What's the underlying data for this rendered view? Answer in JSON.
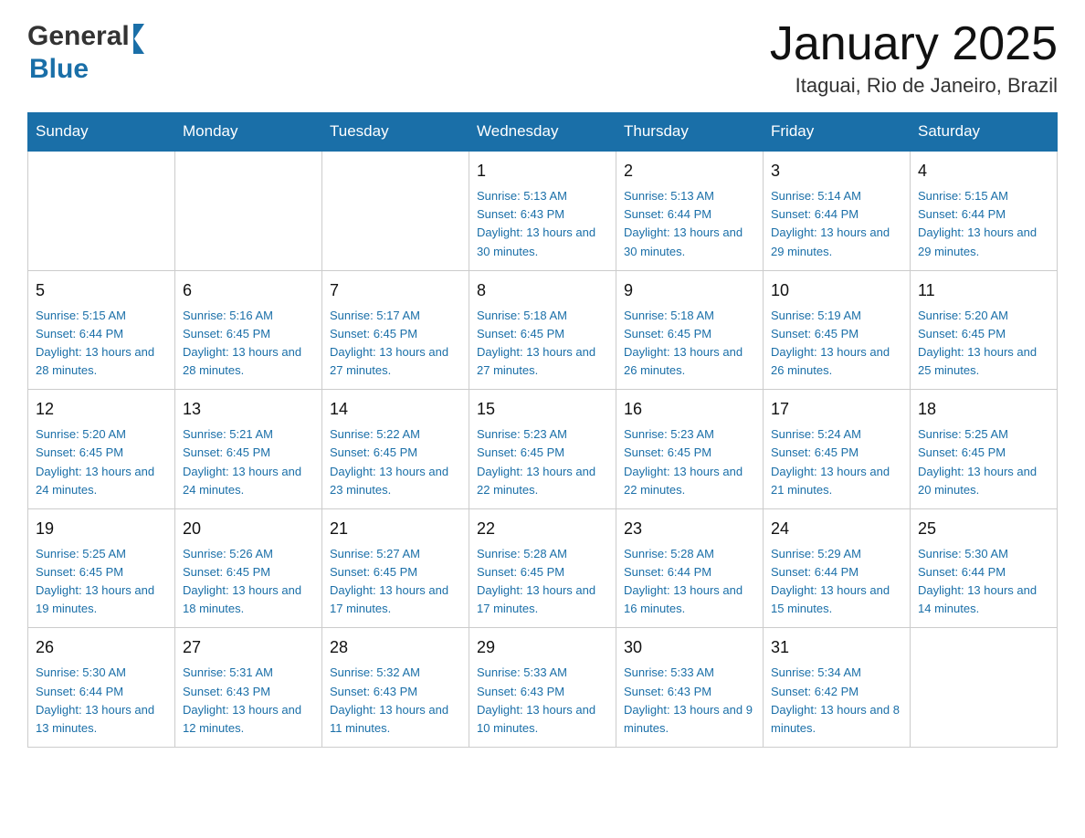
{
  "header": {
    "title": "January 2025",
    "subtitle": "Itaguai, Rio de Janeiro, Brazil",
    "logo_general": "General",
    "logo_blue": "Blue"
  },
  "days_of_week": [
    "Sunday",
    "Monday",
    "Tuesday",
    "Wednesday",
    "Thursday",
    "Friday",
    "Saturday"
  ],
  "weeks": [
    {
      "days": [
        {
          "num": "",
          "info": ""
        },
        {
          "num": "",
          "info": ""
        },
        {
          "num": "",
          "info": ""
        },
        {
          "num": "1",
          "info": "Sunrise: 5:13 AM\nSunset: 6:43 PM\nDaylight: 13 hours and 30 minutes."
        },
        {
          "num": "2",
          "info": "Sunrise: 5:13 AM\nSunset: 6:44 PM\nDaylight: 13 hours and 30 minutes."
        },
        {
          "num": "3",
          "info": "Sunrise: 5:14 AM\nSunset: 6:44 PM\nDaylight: 13 hours and 29 minutes."
        },
        {
          "num": "4",
          "info": "Sunrise: 5:15 AM\nSunset: 6:44 PM\nDaylight: 13 hours and 29 minutes."
        }
      ]
    },
    {
      "days": [
        {
          "num": "5",
          "info": "Sunrise: 5:15 AM\nSunset: 6:44 PM\nDaylight: 13 hours and 28 minutes."
        },
        {
          "num": "6",
          "info": "Sunrise: 5:16 AM\nSunset: 6:45 PM\nDaylight: 13 hours and 28 minutes."
        },
        {
          "num": "7",
          "info": "Sunrise: 5:17 AM\nSunset: 6:45 PM\nDaylight: 13 hours and 27 minutes."
        },
        {
          "num": "8",
          "info": "Sunrise: 5:18 AM\nSunset: 6:45 PM\nDaylight: 13 hours and 27 minutes."
        },
        {
          "num": "9",
          "info": "Sunrise: 5:18 AM\nSunset: 6:45 PM\nDaylight: 13 hours and 26 minutes."
        },
        {
          "num": "10",
          "info": "Sunrise: 5:19 AM\nSunset: 6:45 PM\nDaylight: 13 hours and 26 minutes."
        },
        {
          "num": "11",
          "info": "Sunrise: 5:20 AM\nSunset: 6:45 PM\nDaylight: 13 hours and 25 minutes."
        }
      ]
    },
    {
      "days": [
        {
          "num": "12",
          "info": "Sunrise: 5:20 AM\nSunset: 6:45 PM\nDaylight: 13 hours and 24 minutes."
        },
        {
          "num": "13",
          "info": "Sunrise: 5:21 AM\nSunset: 6:45 PM\nDaylight: 13 hours and 24 minutes."
        },
        {
          "num": "14",
          "info": "Sunrise: 5:22 AM\nSunset: 6:45 PM\nDaylight: 13 hours and 23 minutes."
        },
        {
          "num": "15",
          "info": "Sunrise: 5:23 AM\nSunset: 6:45 PM\nDaylight: 13 hours and 22 minutes."
        },
        {
          "num": "16",
          "info": "Sunrise: 5:23 AM\nSunset: 6:45 PM\nDaylight: 13 hours and 22 minutes."
        },
        {
          "num": "17",
          "info": "Sunrise: 5:24 AM\nSunset: 6:45 PM\nDaylight: 13 hours and 21 minutes."
        },
        {
          "num": "18",
          "info": "Sunrise: 5:25 AM\nSunset: 6:45 PM\nDaylight: 13 hours and 20 minutes."
        }
      ]
    },
    {
      "days": [
        {
          "num": "19",
          "info": "Sunrise: 5:25 AM\nSunset: 6:45 PM\nDaylight: 13 hours and 19 minutes."
        },
        {
          "num": "20",
          "info": "Sunrise: 5:26 AM\nSunset: 6:45 PM\nDaylight: 13 hours and 18 minutes."
        },
        {
          "num": "21",
          "info": "Sunrise: 5:27 AM\nSunset: 6:45 PM\nDaylight: 13 hours and 17 minutes."
        },
        {
          "num": "22",
          "info": "Sunrise: 5:28 AM\nSunset: 6:45 PM\nDaylight: 13 hours and 17 minutes."
        },
        {
          "num": "23",
          "info": "Sunrise: 5:28 AM\nSunset: 6:44 PM\nDaylight: 13 hours and 16 minutes."
        },
        {
          "num": "24",
          "info": "Sunrise: 5:29 AM\nSunset: 6:44 PM\nDaylight: 13 hours and 15 minutes."
        },
        {
          "num": "25",
          "info": "Sunrise: 5:30 AM\nSunset: 6:44 PM\nDaylight: 13 hours and 14 minutes."
        }
      ]
    },
    {
      "days": [
        {
          "num": "26",
          "info": "Sunrise: 5:30 AM\nSunset: 6:44 PM\nDaylight: 13 hours and 13 minutes."
        },
        {
          "num": "27",
          "info": "Sunrise: 5:31 AM\nSunset: 6:43 PM\nDaylight: 13 hours and 12 minutes."
        },
        {
          "num": "28",
          "info": "Sunrise: 5:32 AM\nSunset: 6:43 PM\nDaylight: 13 hours and 11 minutes."
        },
        {
          "num": "29",
          "info": "Sunrise: 5:33 AM\nSunset: 6:43 PM\nDaylight: 13 hours and 10 minutes."
        },
        {
          "num": "30",
          "info": "Sunrise: 5:33 AM\nSunset: 6:43 PM\nDaylight: 13 hours and 9 minutes."
        },
        {
          "num": "31",
          "info": "Sunrise: 5:34 AM\nSunset: 6:42 PM\nDaylight: 13 hours and 8 minutes."
        },
        {
          "num": "",
          "info": ""
        }
      ]
    }
  ]
}
